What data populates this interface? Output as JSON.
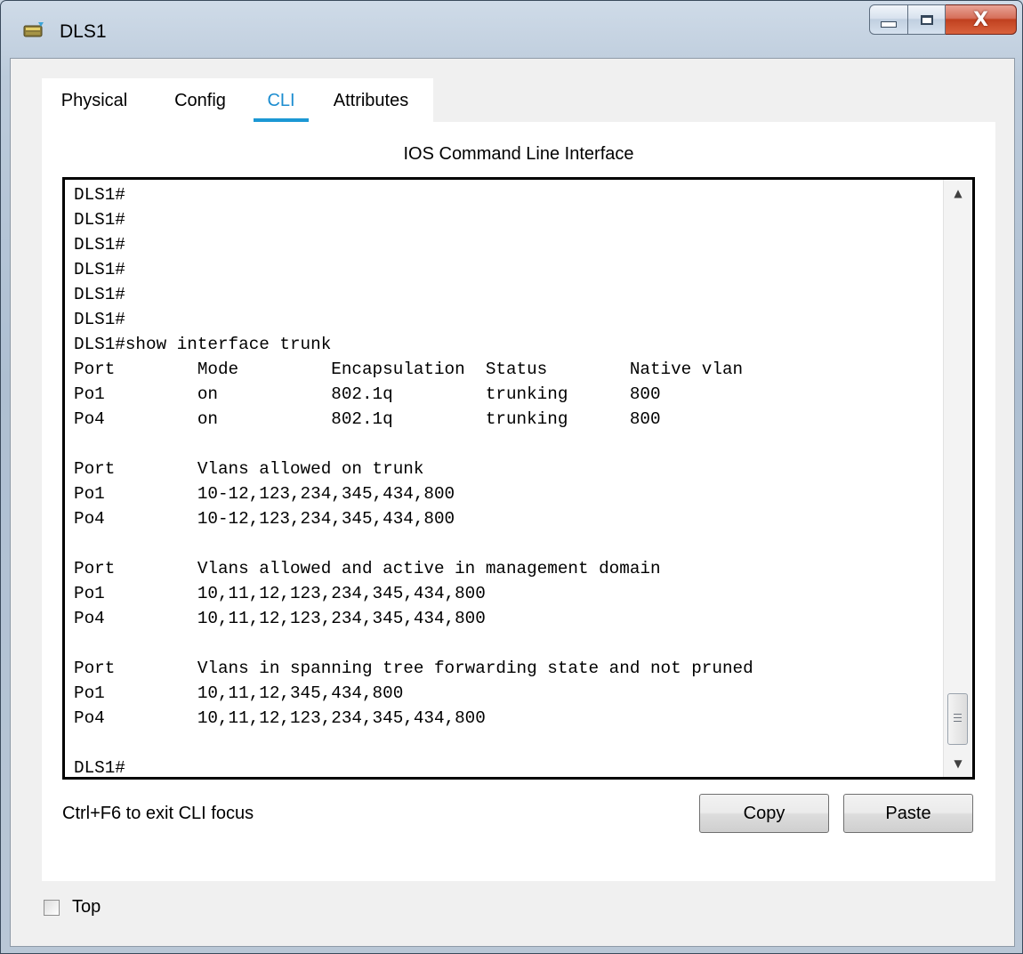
{
  "window": {
    "title": "DLS1",
    "controls": {
      "minimize_icon": "minimize-icon",
      "maximize_icon": "maximize-icon",
      "close_icon": "close-icon",
      "close_glyph": "X"
    }
  },
  "tabs": [
    {
      "label": "Physical",
      "active": false
    },
    {
      "label": "Config",
      "active": false
    },
    {
      "label": "CLI",
      "active": true
    },
    {
      "label": "Attributes",
      "active": false
    }
  ],
  "panel": {
    "title": "IOS Command Line Interface"
  },
  "terminal": {
    "lines": [
      "DLS1#",
      "DLS1#",
      "DLS1#",
      "DLS1#",
      "DLS1#",
      "DLS1#",
      "DLS1#show interface trunk",
      "Port        Mode         Encapsulation  Status        Native vlan",
      "Po1         on           802.1q         trunking      800",
      "Po4         on           802.1q         trunking      800",
      "",
      "Port        Vlans allowed on trunk",
      "Po1         10-12,123,234,345,434,800",
      "Po4         10-12,123,234,345,434,800",
      "",
      "Port        Vlans allowed and active in management domain",
      "Po1         10,11,12,123,234,345,434,800",
      "Po4         10,11,12,123,234,345,434,800",
      "",
      "Port        Vlans in spanning tree forwarding state and not pruned",
      "Po1         10,11,12,345,434,800",
      "Po4         10,11,12,123,234,345,434,800",
      "",
      "DLS1#"
    ],
    "scroll_up_glyph": "▲",
    "scroll_down_glyph": "▼"
  },
  "footer": {
    "hint": "Ctrl+F6 to exit CLI focus",
    "copy_label": "Copy",
    "paste_label": "Paste"
  },
  "top_checkbox": {
    "label": "Top",
    "checked": false
  },
  "colors": {
    "accent": "#1c98d4",
    "active_tab_text": "#1c8dd0",
    "close_button": "#c94a2c"
  }
}
